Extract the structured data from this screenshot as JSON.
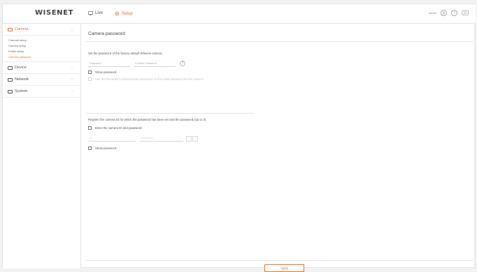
{
  "app": {
    "logo": "WISENET"
  },
  "topnav": {
    "live_label": "Live",
    "setup_label": "Setup"
  },
  "top_right": {
    "user": "admin",
    "help_glyph": "?"
  },
  "sidebar": {
    "camera": {
      "label": "Camera",
      "items": [
        "Channel setup",
        "Camera setup",
        "Profile setup",
        "Camera password"
      ]
    },
    "device": {
      "label": "Device"
    },
    "network": {
      "label": "Network"
    },
    "system": {
      "label": "System"
    }
  },
  "page": {
    "title": "Camera password",
    "section1": {
      "title": "Set the password of the factory default Wisenet camera.",
      "password_placeholder": "Password",
      "confirm_placeholder": "Confirm Password",
      "help_glyph": "?",
      "show_password": "Show password",
      "use_default": "Use the Recorder's administrator password as the initial password for the camera"
    },
    "section2": {
      "title": "Register the camera ID for which the password has been set and the password.(Up to 3)",
      "enter_id": "Enter the camera ID and password",
      "id_placeholder": "ID",
      "password_placeholder": "Password",
      "minus": "−",
      "plus": "+",
      "show_password": "Show password"
    },
    "apply_label": "Apply"
  },
  "colors": {
    "accent": "#e8732b"
  }
}
